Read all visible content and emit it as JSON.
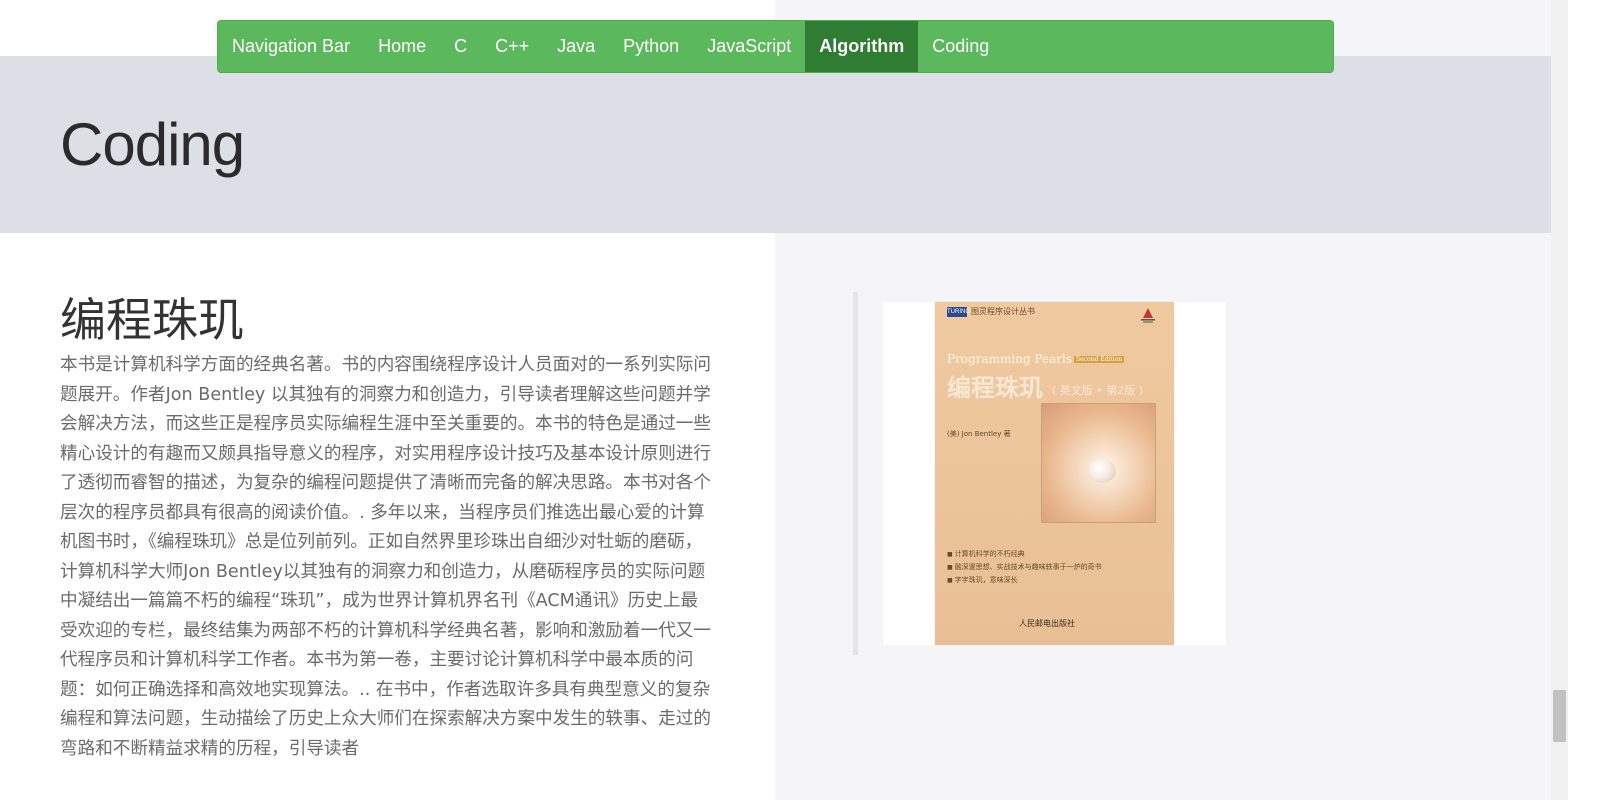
{
  "navbar": {
    "brand": "Navigation Bar",
    "items": [
      {
        "label": "Home",
        "active": false
      },
      {
        "label": "C",
        "active": false
      },
      {
        "label": "C++",
        "active": false
      },
      {
        "label": "Java",
        "active": false
      },
      {
        "label": "Python",
        "active": false
      },
      {
        "label": "JavaScript",
        "active": false
      },
      {
        "label": "Algorithm",
        "active": true
      },
      {
        "label": "Coding",
        "active": false
      }
    ],
    "colors": {
      "bar": "#5cb85c",
      "active": "#2f7d32",
      "text": "#ffffff"
    }
  },
  "jumbotron": {
    "title": "Coding"
  },
  "article": {
    "title": "编程珠玑",
    "body": "本书是计算机科学方面的经典名著。书的内容围绕程序设计人员面对的一系列实际问题展开。作者Jon Bentley 以其独有的洞察力和创造力，引导读者理解这些问题并学会解决方法，而这些正是程序员实际编程生涯中至关重要的。本书的特色是通过一些精心设计的有趣而又颇具指导意义的程序，对实用程序设计技巧及基本设计原则进行了透彻而睿智的描述，为复杂的编程问题提供了清晰而完备的解决思路。本书对各个层次的程序员都具有很高的阅读价值。. 多年以来，当程序员们推选出最心爱的计算机图书时，《编程珠玑》总是位列前列。正如自然界里珍珠出自细沙对牡蛎的磨砺，计算机科学大师Jon Bentley以其独有的洞察力和创造力，从磨砺程序员的实际问题中凝结出一篇篇不朽的编程“珠玑”，成为世界计算机界名刊《ACM通讯》历史上最受欢迎的专栏，最终结集为两部不朽的计算机科学经典名著，影响和激励着一代又一代程序员和计算机科学工作者。本书为第一卷，主要讨论计算机科学中最本质的问题：如何正确选择和高效地实现算法。.. 在书中，作者选取许多具有典型意义的复杂编程和算法问题，生动描绘了历史上众大师们在探索解决方案中发生的轶事、走过的弯路和不断精益求精的历程，引导读者"
  },
  "cover": {
    "series_logo": "TURING",
    "series": "图灵程序设计丛书",
    "en_title": "Programming Pearls",
    "edition_tag": "Second Edition",
    "cn_title": "编程珠玑",
    "cn_sub": "( 英文版 • 第2版 )",
    "author": "(美) Jon Bentley  著",
    "bullets": [
      "计算机科学的不朽经典",
      "融深邃思想、实战技术与趣味轶事于一炉的奇书",
      "字字珠玑，意味深长"
    ],
    "press": "人民邮电出版社"
  }
}
